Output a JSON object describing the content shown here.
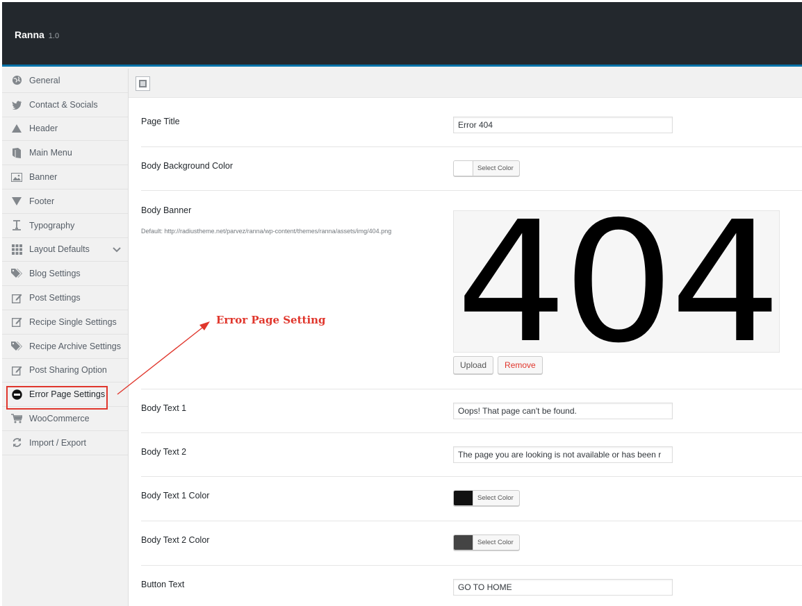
{
  "header": {
    "app_name": "Ranna",
    "version": "1.0"
  },
  "sidebar": {
    "items": [
      {
        "label": "General",
        "icon": "globe-icon"
      },
      {
        "label": "Contact & Socials",
        "icon": "twitter-icon"
      },
      {
        "label": "Header",
        "icon": "triangle-up-icon"
      },
      {
        "label": "Main Menu",
        "icon": "book-icon"
      },
      {
        "label": "Banner",
        "icon": "image-icon"
      },
      {
        "label": "Footer",
        "icon": "triangle-down-icon"
      },
      {
        "label": "Typography",
        "icon": "text-icon"
      },
      {
        "label": "Layout Defaults",
        "icon": "grid-icon"
      },
      {
        "label": "Blog Settings",
        "icon": "tags-icon"
      },
      {
        "label": "Post Settings",
        "icon": "edit-icon"
      },
      {
        "label": "Recipe Single Settings",
        "icon": "edit-icon"
      },
      {
        "label": "Recipe Archive Settings",
        "icon": "tags-icon"
      },
      {
        "label": "Post Sharing Option",
        "icon": "edit-icon"
      },
      {
        "label": "Error Page Settings",
        "icon": "minus-circle-icon"
      },
      {
        "label": "WooCommerce",
        "icon": "cart-icon"
      },
      {
        "label": "Import / Export",
        "icon": "refresh-icon"
      }
    ],
    "active_item": "Error Page Settings"
  },
  "fields": {
    "page_title": {
      "label": "Page Title",
      "value": "Error 404"
    },
    "body_bg_color": {
      "label": "Body Background Color",
      "button": "Select Color",
      "color": "#ffffff"
    },
    "body_banner": {
      "label": "Body Banner",
      "default_text": "Default: http://radiustheme.net/parvez/ranna/wp-content/themes/ranna/assets/img/404.png",
      "image_text": "404",
      "upload_label": "Upload",
      "remove_label": "Remove"
    },
    "body_text_1": {
      "label": "Body Text 1",
      "value": "Oops! That page can't be found."
    },
    "body_text_2": {
      "label": "Body Text 2",
      "value": "The page you are looking is not available or has been r"
    },
    "body_text_1_color": {
      "label": "Body Text 1 Color",
      "button": "Select Color",
      "color": "#111111"
    },
    "body_text_2_color": {
      "label": "Body Text 2 Color",
      "button": "Select Color",
      "color": "#444444"
    },
    "button_text": {
      "label": "Button Text",
      "value": "GO TO HOME"
    }
  },
  "annotation": {
    "text": "Error Page Setting",
    "color": "#e0362c"
  },
  "colors": {
    "topbar": "#23282d",
    "accent": "#0073aa",
    "annotation": "#e0362c"
  }
}
